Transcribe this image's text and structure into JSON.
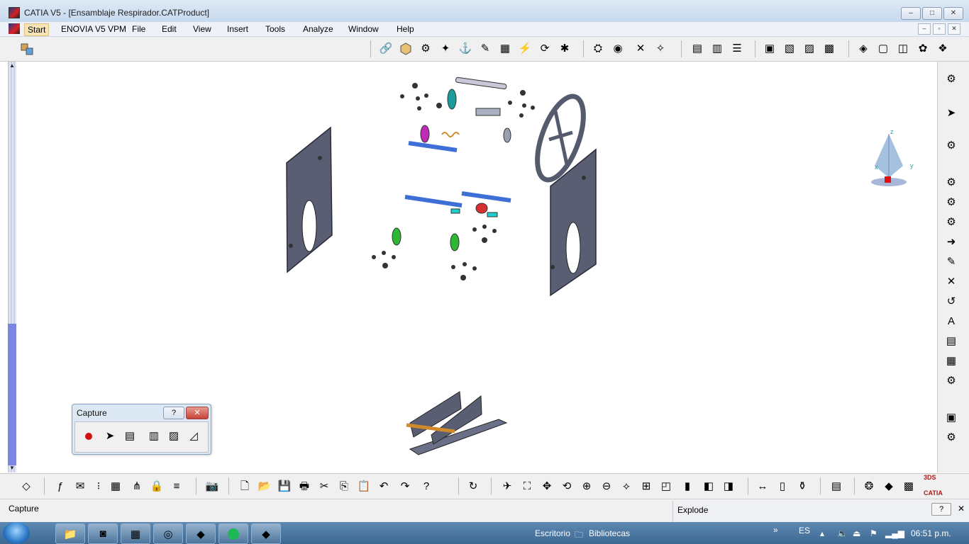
{
  "window": {
    "title": "CATIA V5 - [Ensamblaje Respirador.CATProduct]",
    "controls": [
      "–",
      "□",
      "✕"
    ]
  },
  "menu": {
    "items": [
      "Start",
      "ENOVIA V5 VPM",
      "File",
      "Edit",
      "View",
      "Insert",
      "Tools",
      "Analyze",
      "Window",
      "Help"
    ],
    "mdi_controls": [
      "–",
      "▫",
      "✕"
    ]
  },
  "capture_panel": {
    "title": "Capture",
    "help": "?",
    "close": "✕"
  },
  "status": {
    "left_text": "Capture",
    "right_title": "Explode",
    "help": "?",
    "close": "✕"
  },
  "compass": {
    "x_label": "x",
    "y_label": "y",
    "z_label": "z"
  },
  "axis": {
    "x_label": "x",
    "y_label": "y",
    "z_label": "z"
  },
  "taskbar": {
    "escritorio": "Escritorio",
    "bibliotecas": "Bibliotecas",
    "lang": "ES",
    "time": "06:51 p.m.",
    "chevron": "»"
  },
  "colors": {
    "plate": "#5a5e73",
    "shaft": "#3e6fd6",
    "green": "#2db833",
    "magenta": "#c02ab5",
    "teal": "#1b9b9b",
    "red": "#d63030",
    "orange": "#d08a2a"
  }
}
